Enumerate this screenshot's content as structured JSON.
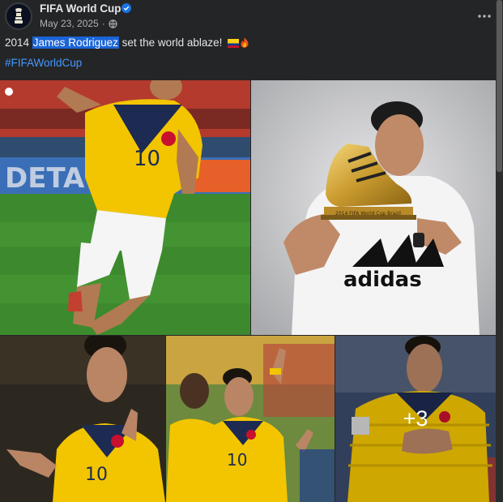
{
  "post": {
    "page_name": "FIFA World Cup",
    "date": "May 23, 2025",
    "separator": "·",
    "caption_before": "2014 ",
    "caption_highlight": "James Rodriguez",
    "caption_after": " set the world ablaze! ",
    "hashtag": "#FIFAWorldCup"
  },
  "photos": {
    "more_count": "+3",
    "trophy_label": "2014 FIFA World Cup Brazil",
    "shirt_brand": "adidas",
    "jersey_number": "10",
    "board_text": "DETA"
  },
  "icons": {
    "verified": "verified-badge-icon",
    "globe": "globe-icon",
    "more": "more-options-icon",
    "flag": "colombia-flag-emoji",
    "fire": "fire-emoji"
  },
  "colors": {
    "background": "#242526",
    "hashtag": "#4599ff",
    "highlight": "#1b64d6",
    "jersey_yellow": "#f2c500"
  }
}
